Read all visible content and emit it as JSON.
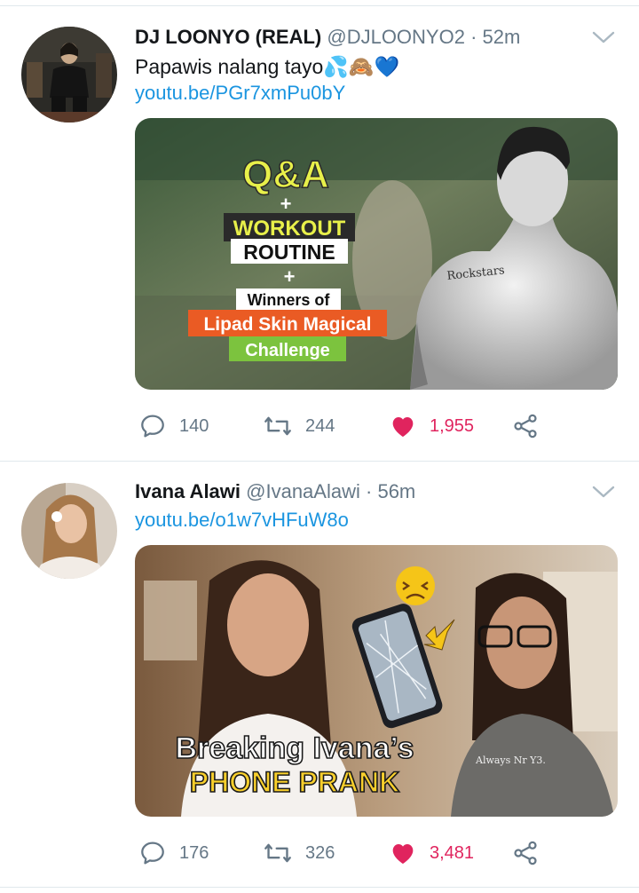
{
  "tweets": [
    {
      "name": "DJ LOONYO (REAL)",
      "handle": "@DJLOONYO2",
      "dot": "·",
      "time": "52m",
      "text": "Papawis nalang tayo💦🙈💙",
      "link": "youtu.be/PGr7xmPu0bY",
      "thumbnail": {
        "line1": "Q&A",
        "plus1": "+",
        "line2": "WORKOUT",
        "line3": "ROUTINE",
        "plus2": "+",
        "line4": "Winners of",
        "line5": "Lipad Skin Magical",
        "line6": "Challenge",
        "tattoo": "Rockstars"
      },
      "replies": "140",
      "retweets": "244",
      "likes": "1,955"
    },
    {
      "name": "Ivana Alawi",
      "handle": "@IvanaAlawi",
      "dot": "·",
      "time": "56m",
      "link": "youtu.be/o1w7vHFuW8o",
      "thumbnail": {
        "line1": "Breaking Ivana’s",
        "line2": "PHONE PRANK",
        "shirt": "Always Nr Y3."
      },
      "replies": "176",
      "retweets": "326",
      "likes": "3,481"
    }
  ],
  "colors": {
    "link": "#1b95e0",
    "secondary_text": "#657786",
    "like": "#e0245e",
    "divider": "#e1e8ed"
  }
}
